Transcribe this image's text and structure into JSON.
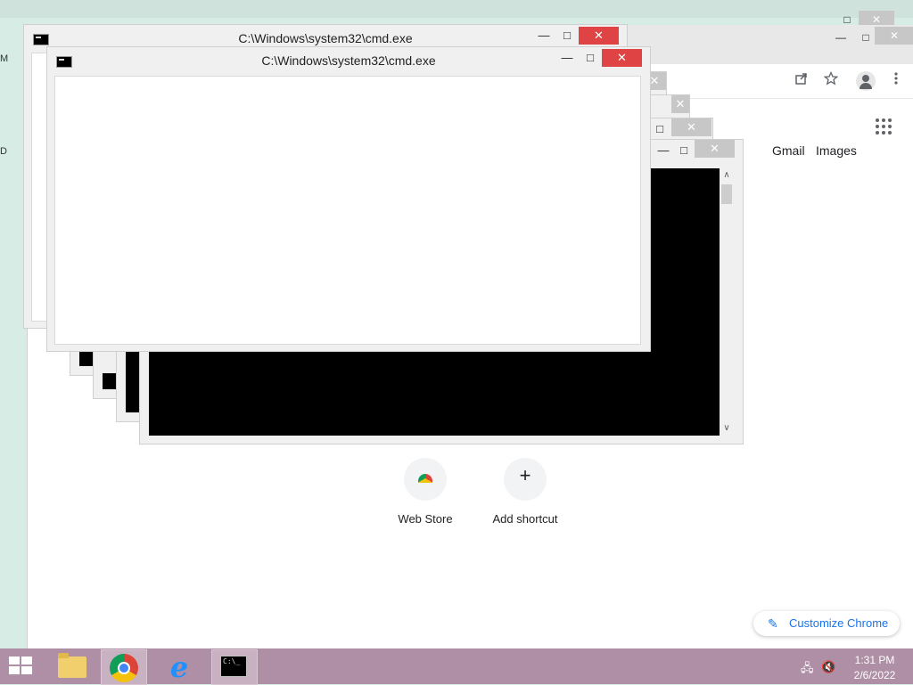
{
  "desktop": {
    "edge_letters": [
      "M",
      "D"
    ]
  },
  "chrome_window": {
    "controls": {
      "minimize": "—",
      "maximize": "□",
      "close": "✕"
    },
    "toolbar_icons": [
      "share-icon",
      "star-icon",
      "profile-icon",
      "more-icon"
    ],
    "header_links": {
      "gmail": "Gmail",
      "images": "Images"
    },
    "shortcuts": [
      {
        "label": "Web Store",
        "icon": "chrome-webstore-icon"
      },
      {
        "label": "Add shortcut",
        "icon": "plus-icon",
        "glyph": "+"
      }
    ],
    "customize_label": "Customize Chrome"
  },
  "cmd_window_back": {
    "title": "C:\\Windows\\system32\\cmd.exe",
    "controls": {
      "minimize": "—",
      "maximize": "□",
      "close": "✕"
    }
  },
  "cmd_window_front": {
    "title": "C:\\Windows\\system32\\cmd.exe",
    "controls": {
      "minimize": "—",
      "maximize": "□",
      "close": "✕"
    }
  },
  "stacked_window_controls": {
    "minimize": "—",
    "maximize": "□",
    "close": "✕"
  },
  "scrollbar": {
    "up": "∧",
    "down": "∨"
  },
  "taskbar": {
    "apps": [
      "file-explorer",
      "google-chrome",
      "internet-explorer",
      "command-prompt"
    ],
    "cmd_icon_text": "C:\\_",
    "clock_time": "1:31 PM",
    "clock_date": "2/6/2022",
    "tray_icons": [
      "network-icon",
      "volume-muted-icon"
    ]
  },
  "colors": {
    "taskbar": "#ae8fa6",
    "close_red": "#e04343",
    "link_blue": "#1a73e8"
  }
}
